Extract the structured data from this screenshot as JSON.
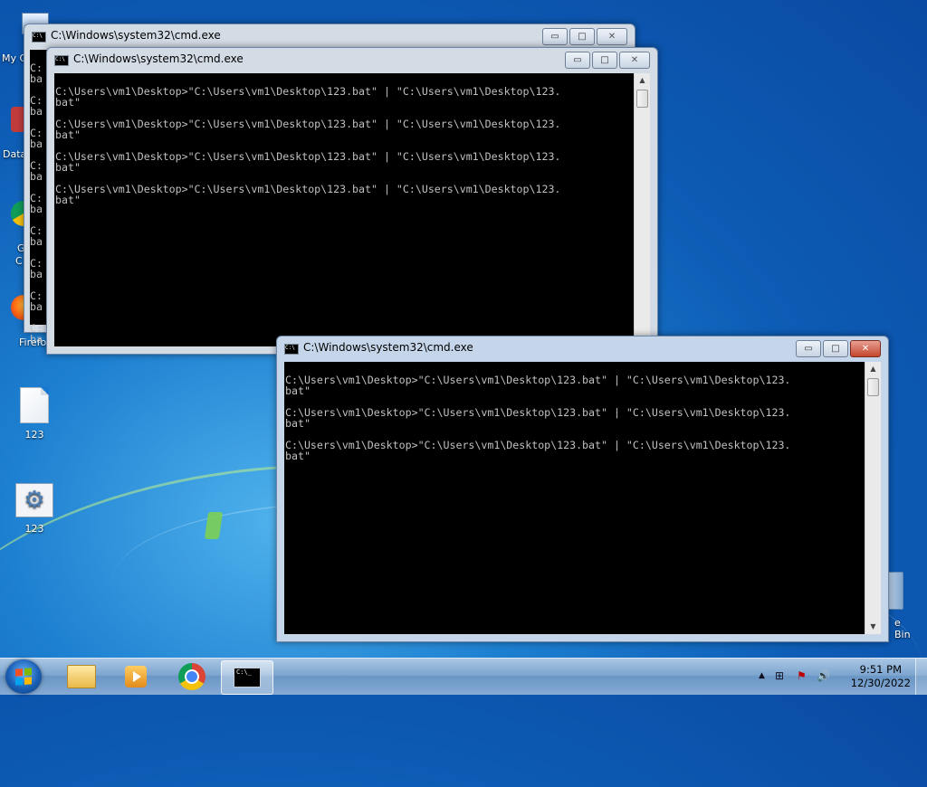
{
  "desktop": {
    "icons": [
      {
        "label": "123",
        "kind": "text-file"
      },
      {
        "label": "123",
        "kind": "batch-file"
      }
    ],
    "edge_labels": [
      "My C",
      "Data",
      "G",
      "C",
      "Firefo"
    ],
    "right_edge_label": "e Bin"
  },
  "windows": [
    {
      "title": "C:\\Windows\\system32\\cmd.exe",
      "state": "inactive",
      "visible_lines": [
        "C:",
        "ba",
        "C:",
        "ba",
        "C:",
        "ba",
        "C:",
        "ba",
        "C:",
        "ba",
        "C:",
        "ba",
        "C:",
        "ba",
        "C:",
        "ba",
        "C:",
        "ba"
      ]
    },
    {
      "title": "C:\\Windows\\system32\\cmd.exe",
      "state": "inactive",
      "console_text": "C:\\Users\\vm1\\Desktop>\"C:\\Users\\vm1\\Desktop\\123.bat\" | \"C:\\Users\\vm1\\Desktop\\123.\nbat\"\n\nC:\\Users\\vm1\\Desktop>\"C:\\Users\\vm1\\Desktop\\123.bat\" | \"C:\\Users\\vm1\\Desktop\\123.\nbat\"\n\nC:\\Users\\vm1\\Desktop>\"C:\\Users\\vm1\\Desktop\\123.bat\" | \"C:\\Users\\vm1\\Desktop\\123.\nbat\"\n\nC:\\Users\\vm1\\Desktop>\"C:\\Users\\vm1\\Desktop\\123.bat\" | \"C:\\Users\\vm1\\Desktop\\123.\nbat\""
    },
    {
      "title": "C:\\Windows\\system32\\cmd.exe",
      "state": "active",
      "console_text": "C:\\Users\\vm1\\Desktop>\"C:\\Users\\vm1\\Desktop\\123.bat\" | \"C:\\Users\\vm1\\Desktop\\123.\nbat\"\n\nC:\\Users\\vm1\\Desktop>\"C:\\Users\\vm1\\Desktop\\123.bat\" | \"C:\\Users\\vm1\\Desktop\\123.\nbat\"\n\nC:\\Users\\vm1\\Desktop>\"C:\\Users\\vm1\\Desktop\\123.bat\" | \"C:\\Users\\vm1\\Desktop\\123.\nbat\""
    }
  ],
  "controls": {
    "minimize": "▭",
    "maximize": "□",
    "close": "✕"
  },
  "taskbar": {
    "pinned": [
      "windows-explorer",
      "windows-media-player",
      "google-chrome",
      "command-prompt"
    ],
    "tray_symbols": [
      "▲",
      "⊞",
      "⚑",
      "🔊"
    ],
    "time": "9:51 PM",
    "date": "12/30/2022"
  },
  "colors": {
    "console_bg": "#000000",
    "console_fg": "#c0c0c0",
    "close_red": "#c4452c"
  }
}
